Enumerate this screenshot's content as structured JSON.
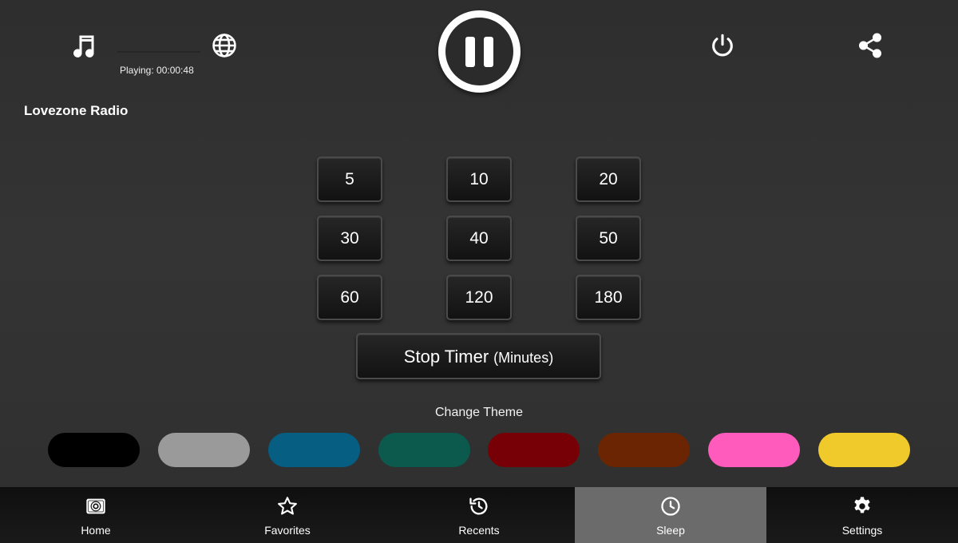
{
  "player": {
    "playing_status": "Playing: 00:00:48",
    "station_name": "Lovezone Radio",
    "icons": {
      "music": "music-note-icon",
      "globe": "globe-icon",
      "pause": "pause-icon",
      "power": "power-icon",
      "share": "share-icon"
    }
  },
  "timer": {
    "options": [
      "5",
      "10",
      "20",
      "30",
      "40",
      "50",
      "60",
      "120",
      "180"
    ],
    "stop_label": "Stop Timer",
    "unit_label": "(Minutes)"
  },
  "themes": {
    "heading": "Change Theme",
    "colors": [
      "#000000",
      "#9a9a9a",
      "#065e82",
      "#0b5a4d",
      "#760005",
      "#6b2503",
      "#ff5bbd",
      "#f0c92a"
    ]
  },
  "nav": {
    "items": [
      {
        "label": "Home",
        "icon": "radio-icon"
      },
      {
        "label": "Favorites",
        "icon": "star-icon"
      },
      {
        "label": "Recents",
        "icon": "history-icon"
      },
      {
        "label": "Sleep",
        "icon": "clock-icon",
        "active": true
      },
      {
        "label": "Settings",
        "icon": "gear-icon"
      }
    ]
  }
}
